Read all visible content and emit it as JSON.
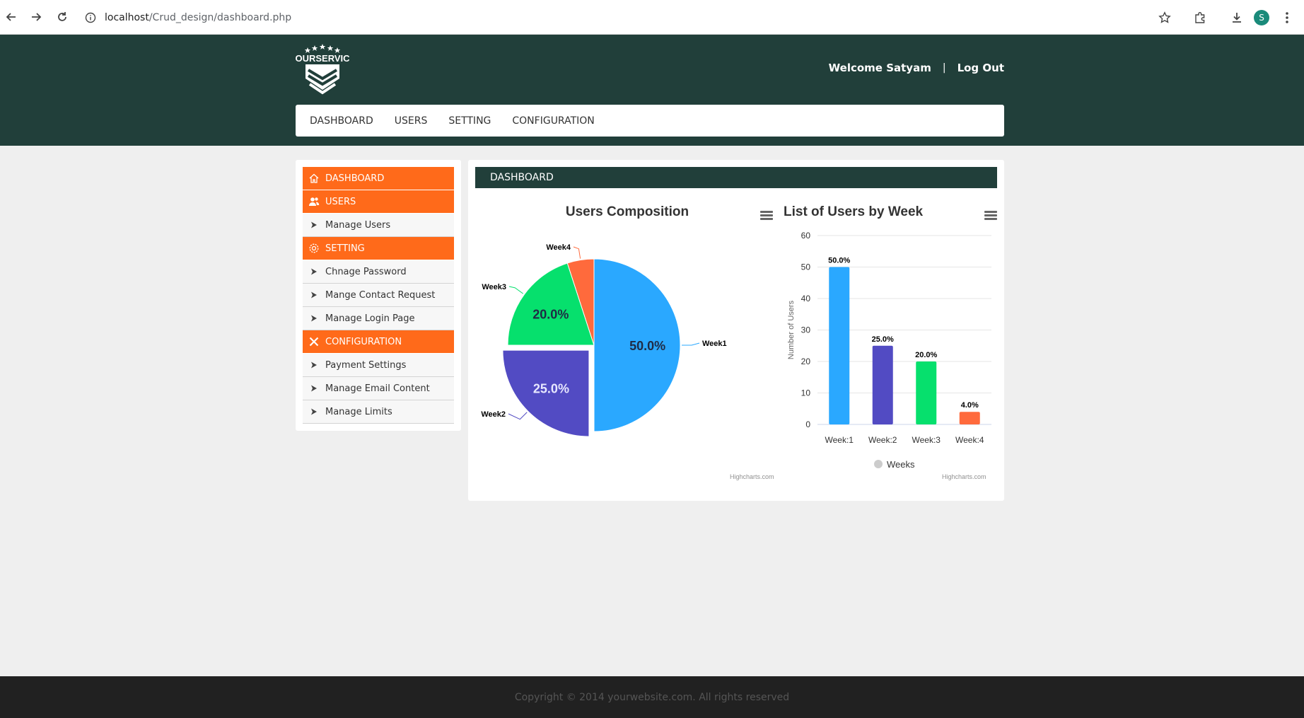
{
  "browser": {
    "url_host": "localhost",
    "url_path": "/Crud_design/dashboard.php",
    "profile_initial": "S"
  },
  "header": {
    "logo_text": "YOURSERVICE",
    "welcome": "Welcome Satyam",
    "separator": "|",
    "logout": "Log Out"
  },
  "topnav": [
    "DASHBOARD",
    "USERS",
    "SETTING",
    "CONFIGURATION"
  ],
  "sidebar": {
    "dashboard": "DASHBOARD",
    "users": "USERS",
    "users_items": [
      "Manage Users"
    ],
    "setting": "SETTING",
    "setting_items": [
      "Chnage Password",
      "Mange Contact Request",
      "Manage Login Page"
    ],
    "configuration": "CONFIGURATION",
    "configuration_items": [
      "Payment Settings",
      "Manage Email Content",
      "Manage Limits"
    ]
  },
  "panel": {
    "title": "DASHBOARD",
    "credit": "Highcharts.com"
  },
  "chart_data": [
    {
      "type": "pie",
      "title": "Users Composition",
      "slices": [
        {
          "name": "Week1",
          "value": 50.0,
          "label": "50.0%",
          "color": "#2aa8ff"
        },
        {
          "name": "Week2",
          "value": 25.0,
          "label": "25.0%",
          "color": "#524bc3"
        },
        {
          "name": "Week3",
          "value": 20.0,
          "label": "20.0%",
          "color": "#06e06d"
        },
        {
          "name": "Week4",
          "value": 5.0,
          "label": "",
          "color": "#ff6a3c"
        }
      ]
    },
    {
      "type": "bar",
      "title": "List of Users by Week",
      "categories": [
        "Week:1",
        "Week:2",
        "Week:3",
        "Week:4"
      ],
      "values": [
        50,
        25,
        20,
        4
      ],
      "data_labels": [
        "50.0%",
        "25.0%",
        "20.0%",
        "4.0%"
      ],
      "colors": [
        "#2aa8ff",
        "#524bc3",
        "#06e06d",
        "#ff6a3c"
      ],
      "ylabel": "Number of Users",
      "ylim": [
        0,
        60
      ],
      "yticks": [
        0,
        10,
        20,
        30,
        40,
        50,
        60
      ],
      "legend": "Weeks",
      "legend_position": "bottom-center",
      "grid": true
    }
  ],
  "footer": {
    "copyright": "Copyright © 2014 yourwebsite.com. All rights reserved"
  }
}
